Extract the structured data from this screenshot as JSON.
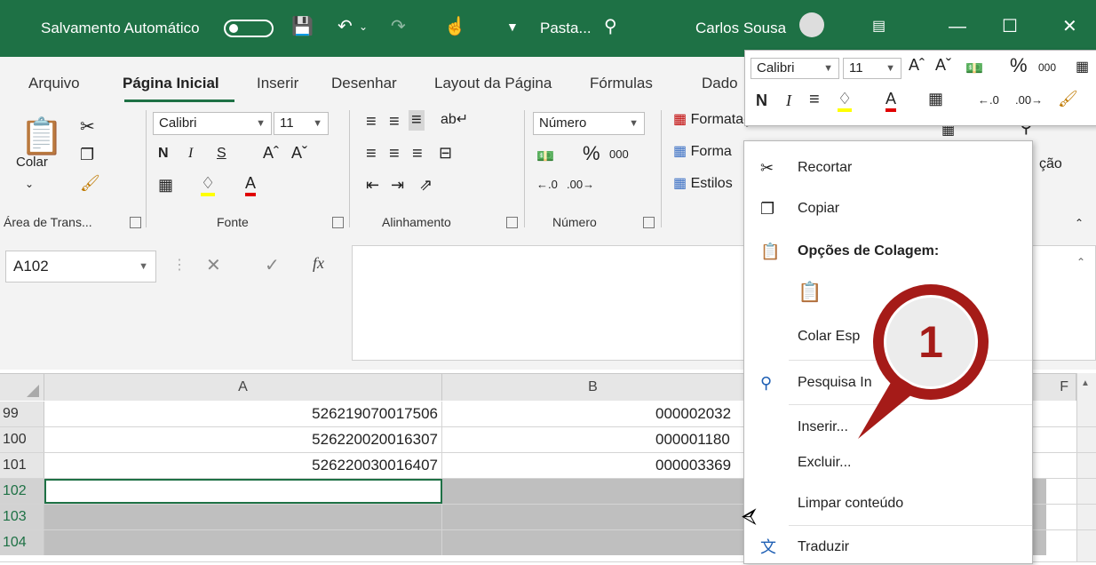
{
  "title_bar": {
    "autosave_label": "Salvamento Automático",
    "document_name": "Pasta...",
    "user_name": "Carlos Sousa",
    "accent_color": "#1e7145"
  },
  "tabs": [
    "Arquivo",
    "Página Inicial",
    "Inserir",
    "Desenhar",
    "Layout da Página",
    "Fórmulas",
    "Dado"
  ],
  "active_tab": "Página Inicial",
  "ribbon": {
    "clipboard": {
      "paste_label": "Colar",
      "group_label": "Área de Trans..."
    },
    "font": {
      "font_name": "Calibri",
      "font_size": "11",
      "bold": "N",
      "italic": "I",
      "underline": "S",
      "group_label": "Fonte"
    },
    "alignment": {
      "group_label": "Alinhamento"
    },
    "number": {
      "format": "Número",
      "percent": "%",
      "thousands": "000",
      "group_label": "Número"
    },
    "styles": {
      "cond_format": "Formatação Condicional",
      "format_table": "Forma",
      "cell_styles": "Estilos"
    },
    "partial_right": "ção"
  },
  "formula_bar": {
    "name_box": "A102",
    "fx": "fx",
    "formula": ""
  },
  "columns": [
    "A",
    "B",
    "F"
  ],
  "rows": [
    {
      "num": "99",
      "a": "526219070017506",
      "b": "000002032"
    },
    {
      "num": "100",
      "a": "526220020016307",
      "b": "000001180"
    },
    {
      "num": "101",
      "a": "526220030016407",
      "b": "000003369"
    },
    {
      "num": "102",
      "a": "",
      "b": ""
    },
    {
      "num": "103",
      "a": "",
      "b": ""
    },
    {
      "num": "104",
      "a": "",
      "b": ""
    }
  ],
  "mini_toolbar": {
    "font_name": "Calibri",
    "font_size": "11",
    "bold": "N",
    "italic": "I",
    "percent": "%",
    "thousands": "000"
  },
  "context_menu": {
    "items": [
      {
        "label": "Recortar",
        "icon": "scissors-icon"
      },
      {
        "label": "Copiar",
        "icon": "copy-icon"
      },
      {
        "label": "Opções de Colagem:",
        "icon": "paste-options-icon"
      },
      {
        "label": "Colar Esp",
        "icon": ""
      },
      {
        "label": "Pesquisa In",
        "icon": "smart-lookup-icon"
      },
      {
        "label": "Inserir...",
        "icon": ""
      },
      {
        "label": "Excluir...",
        "icon": ""
      },
      {
        "label": "Limpar conteúdo",
        "icon": ""
      },
      {
        "label": "Traduzir",
        "icon": "translate-icon"
      }
    ]
  },
  "callout": {
    "number": "1",
    "color": "#a51b18"
  }
}
